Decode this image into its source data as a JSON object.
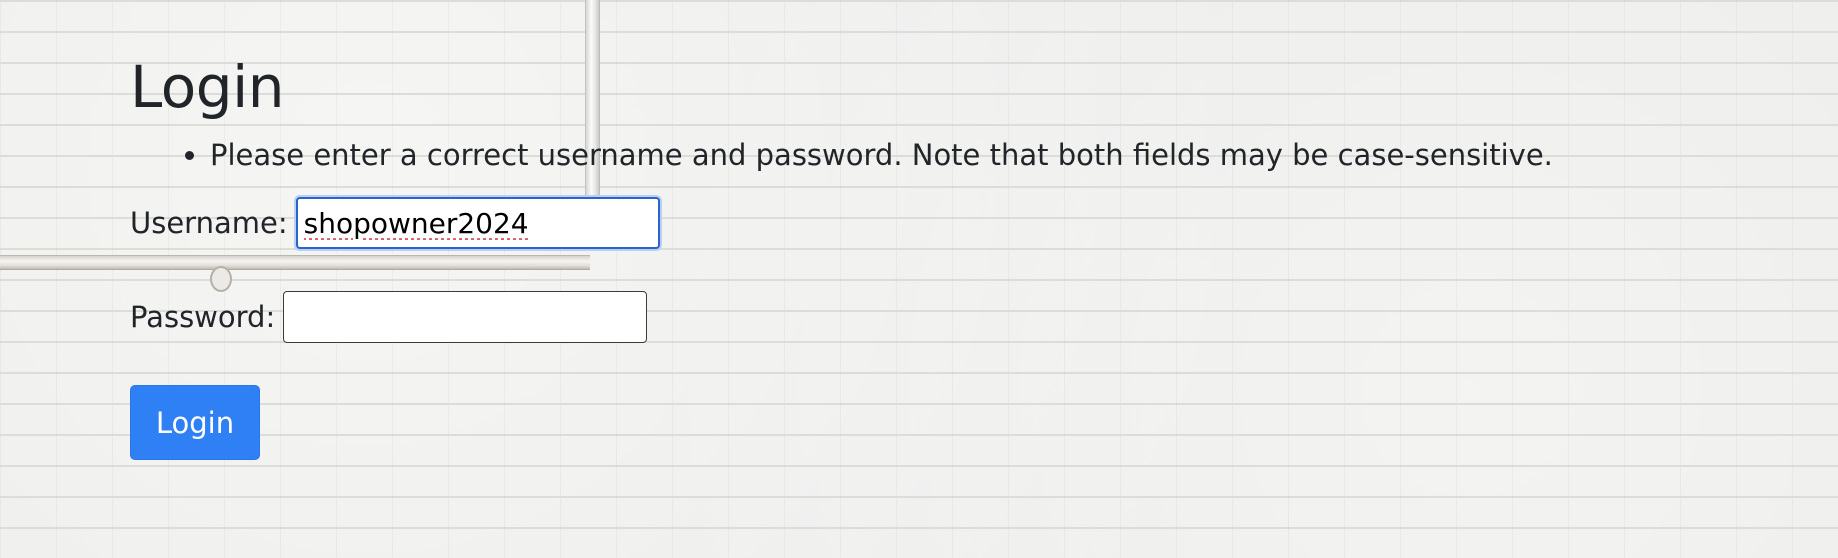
{
  "page": {
    "title": "Login"
  },
  "errors": [
    "Please enter a correct username and password. Note that both fields may be case-sensitive."
  ],
  "form": {
    "username": {
      "label": "Username:",
      "value": "shopowner2024"
    },
    "password": {
      "label": "Password:",
      "value": ""
    },
    "submit_label": "Login"
  },
  "colors": {
    "button_background": "#2f7ff5",
    "focus_border": "#2b64c9",
    "text": "#212529"
  }
}
